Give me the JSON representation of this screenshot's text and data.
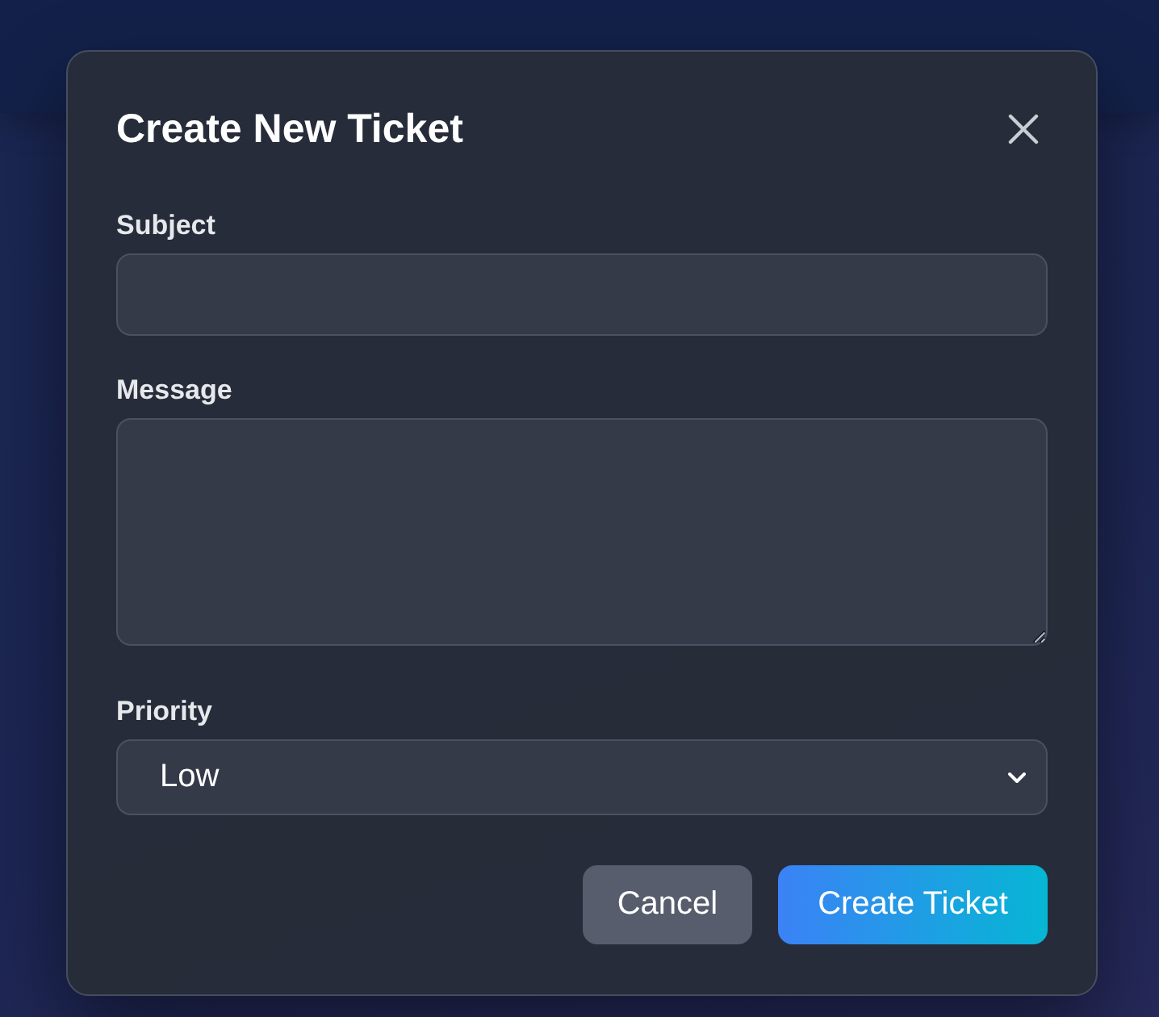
{
  "dialog": {
    "title": "Create New Ticket",
    "fields": [
      {
        "kind": "text",
        "label": "Subject"
      },
      {
        "kind": "textarea",
        "label": "Message"
      },
      {
        "kind": "select",
        "label": "Priority",
        "value": "Low"
      }
    ],
    "buttons": [
      {
        "kind": "secondary",
        "label": "Cancel"
      },
      {
        "kind": "primary",
        "label": "Create Ticket"
      }
    ]
  }
}
